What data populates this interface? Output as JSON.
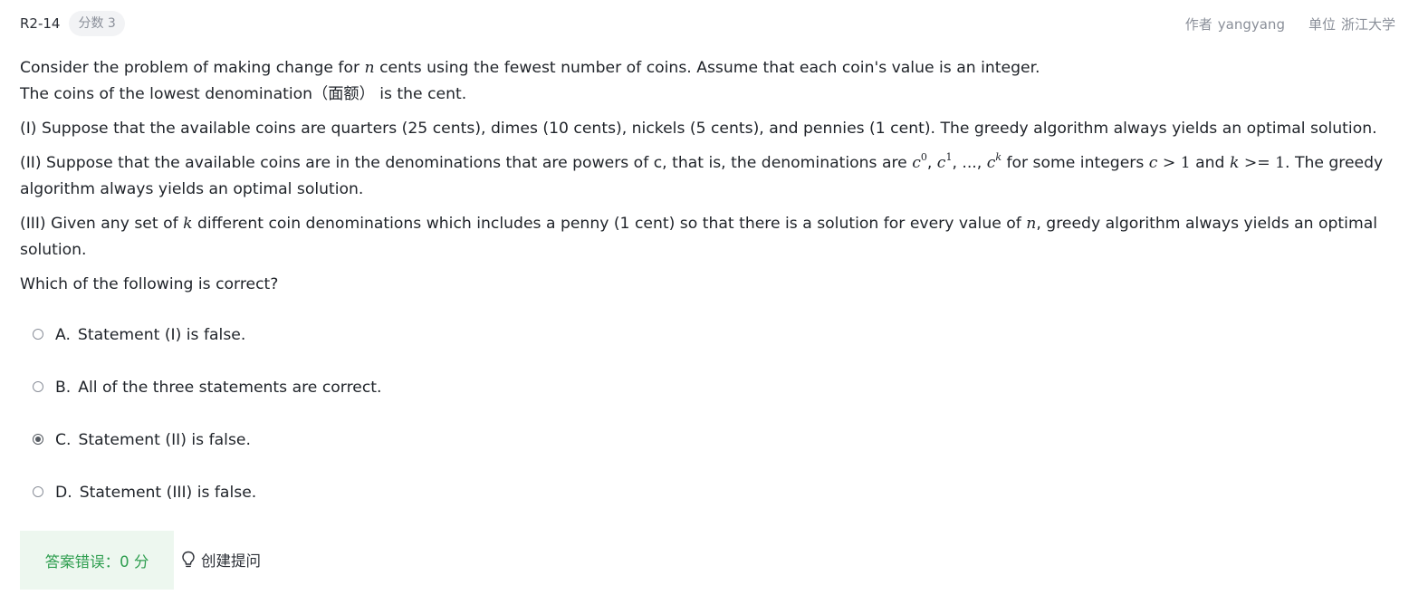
{
  "header": {
    "question_id": "R2-14",
    "score_badge": "分数 3",
    "author_label": "作者",
    "author_value": "yangyang",
    "unit_label": "单位",
    "unit_value": "浙江大学"
  },
  "question": {
    "p1": {
      "a": "Consider the problem of making change for ",
      "n": "n",
      "b": " cents using the fewest number of coins. Assume that each coin's value is an integer."
    },
    "p2": "The coins of the lowest denomination（面额） is the cent.",
    "p3": "(I) Suppose that the available coins are quarters (25 cents), dimes (10 cents), nickels (5 cents), and pennies (1 cent). The greedy algorithm always yields an optimal solution.",
    "p4": {
      "a": "(II) Suppose that the available coins are in the denominations that are powers of c, that is, the denominations are ",
      "c": "c",
      "sup0": "0",
      "sup1": "1",
      "supk": "k",
      "comma": ", ",
      "dots": ", ..., ",
      "b": " for some integers ",
      "cond1_var": "c",
      "cond1_rest": " > 1",
      "and": " and ",
      "cond2_var": "k",
      "cond2_rest": " >= 1",
      "c2": ". The greedy algorithm always yields an optimal solution."
    },
    "p5": {
      "a": "(III) Given any set of ",
      "k": "k",
      "b": " different coin denominations which includes a penny (1 cent) so that there is a solution for every value of ",
      "n": "n",
      "c": ", greedy algorithm always yields an optimal solution."
    },
    "p6": "Which of the following is correct?"
  },
  "options": [
    {
      "letter": "A.",
      "text": "Statement (I) is false.",
      "checked": false
    },
    {
      "letter": "B.",
      "text": "All of the three statements are correct.",
      "checked": false
    },
    {
      "letter": "C.",
      "text": "Statement (II) is false.",
      "checked": true
    },
    {
      "letter": "D.",
      "text": "Statement (III) is false.",
      "checked": false
    }
  ],
  "result": {
    "text": "答案错误：0 分",
    "ask_label": "创建提问"
  },
  "colors": {
    "result_bg": "#edf7ef",
    "result_text": "#2e9e4f",
    "muted_text": "#8a8f99"
  },
  "icons": {
    "ask": "lightbulb-icon",
    "radio": "radio-button"
  }
}
